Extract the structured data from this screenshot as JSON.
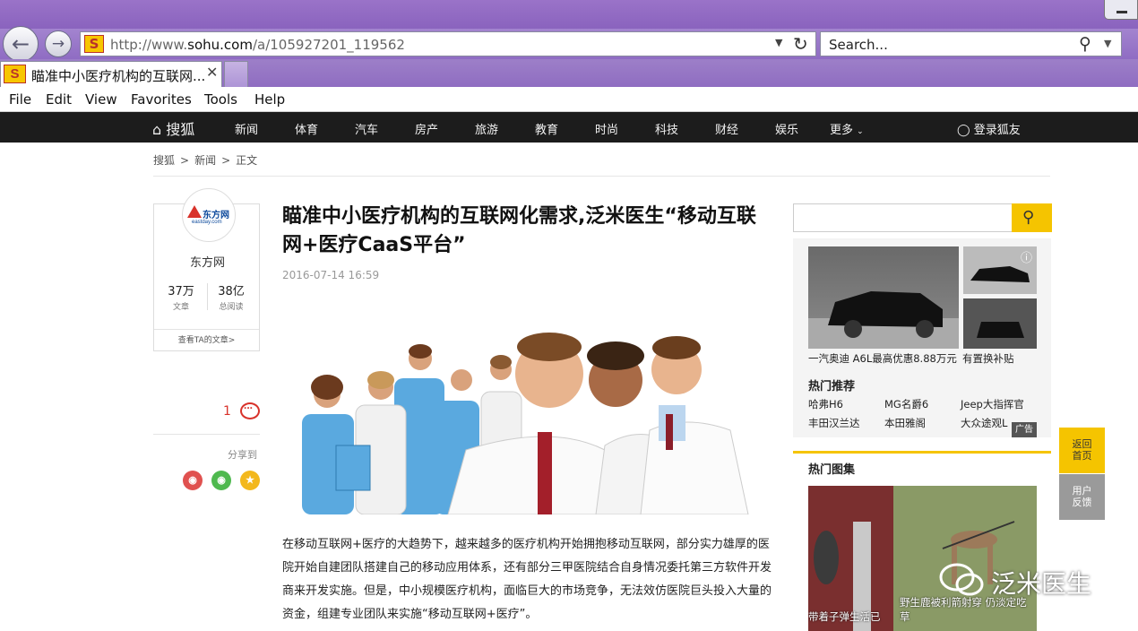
{
  "browser": {
    "url_prefix": "http://www.",
    "url_domain": "sohu.com",
    "url_suffix": "/a/105927201_119562",
    "search_placeholder": "Search...",
    "tab_title": "瞄准中小医疗机构的互联网..."
  },
  "menu": [
    "File",
    "Edit",
    "View",
    "Favorites",
    "Tools",
    "Help"
  ],
  "site_nav": {
    "home": "搜狐",
    "items": [
      "新闻",
      "体育",
      "汽车",
      "房产",
      "旅游",
      "教育",
      "时尚",
      "科技",
      "财经",
      "娱乐",
      "更多"
    ],
    "login": "登录狐友"
  },
  "breadcrumb": [
    "搜狐",
    ">",
    "新闻",
    ">",
    "正文"
  ],
  "author": {
    "logo_text": "东方网",
    "logo_sub": "eastday.com",
    "name": "东方网",
    "articles_num": "37万",
    "articles_label": "文章",
    "reads_num": "38亿",
    "reads_label": "总阅读",
    "view_link": "查看TA的文章>"
  },
  "comments_count": "1",
  "share_label": "分享到",
  "article": {
    "title": "瞄准中小医疗机构的互联网化需求,泛米医生“移动互联网+医疗CaaS平台”",
    "date": "2016-07-14 16:59",
    "body": "在移动互联网+医疗的大趋势下，越来越多的医疗机构开始拥抱移动互联网，部分实力雄厚的医院开始自建团队搭建自己的移动应用体系，还有部分三甲医院结合自身情况委托第三方软件开发商来开发实施。但是，中小规模医疗机构，面临巨大的市场竞争，无法效仿医院巨头投入大量的资金，组建专业团队来实施“移动互联网+医疗”。"
  },
  "sidebar": {
    "ad_caption_1": "一汽奥迪 A6L最高优惠8.88万元",
    "ad_caption_2": "有置换补贴",
    "hot_title": "热门推荐",
    "hot_items": [
      "哈弗H6",
      "MG名爵6",
      "Jeep大指挥官",
      "丰田汉兰达",
      "本田雅阁",
      "大众途观L"
    ],
    "ad_tag": "广告",
    "gallery_title": "热门图集",
    "gallery_caption_1": "带着子弹生活已",
    "gallery_caption_2": "野生鹿被利箭射穿 仍淡定吃草"
  },
  "float_buttons": {
    "top_1": "返回",
    "top_2": "首页",
    "fb_1": "用户",
    "fb_2": "反馈"
  },
  "watermark": "泛米医生",
  "colors": {
    "accent": "#f5c400",
    "nav_bg": "#1c1c1c",
    "browser_chrome": "#8f6cc3",
    "comment_red": "#d8322a"
  }
}
